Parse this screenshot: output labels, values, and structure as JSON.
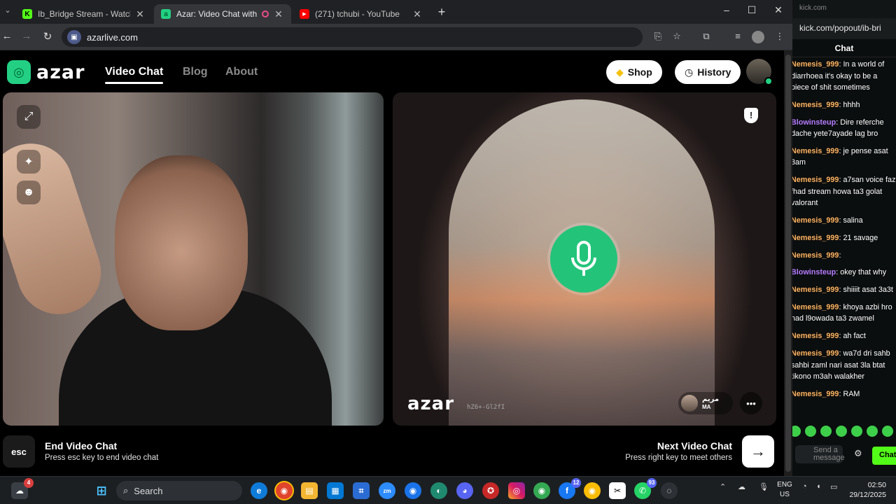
{
  "browser": {
    "tabs": [
      {
        "title": "Ib_Bridge Stream - Watch Live o",
        "favicon": "kick-k"
      },
      {
        "title": "Azar: Video Chat with New",
        "favicon": "azar"
      },
      {
        "title": "(271) tchubi - YouTube",
        "favicon": "youtube"
      }
    ],
    "url": "azarlive.com"
  },
  "azar": {
    "logo_text": "azar",
    "nav": [
      "Video Chat",
      "Blog",
      "About"
    ],
    "shop_label": "Shop",
    "history_label": "History",
    "watermark": "azar",
    "watermark_code": "hZ6+-Gl2fI",
    "partner_name": "مريم",
    "partner_country": "MA",
    "end_title": "End Video Chat",
    "end_sub": "Press esc key to end video chat",
    "esc_label": "esc",
    "next_title": "Next Video Chat",
    "next_sub": "Press right key to meet others",
    "colors": {
      "accent": "#23d083",
      "mic": "#23c47a"
    }
  },
  "popout": {
    "window_title": "kick.com",
    "url": "kick.com/popout/ib-bri",
    "chat_title": "Chat",
    "messages": [
      {
        "user": "Nemesis_999",
        "text": "In a world of diarrhoea it's okay to be a piece of shit sometimes",
        "color": "#ffb25e"
      },
      {
        "user": "Nemesis_999",
        "text": "hhhh",
        "color": "#ffb25e"
      },
      {
        "user": "Blowinsteup",
        "text": "Dire referche dache yete7ayade lag bro",
        "color": "#b57cff"
      },
      {
        "user": "Nemesis_999",
        "text": "je pense asat 3am",
        "color": "#ffb25e"
      },
      {
        "user": "Nemesis_999",
        "text": "a7san voice faz fhad stream howa ta3 golat valorant",
        "color": "#ffb25e"
      },
      {
        "user": "Nemesis_999",
        "text": "salina",
        "color": "#ffb25e"
      },
      {
        "user": "Nemesis_999",
        "text": "21 savage",
        "color": "#ffb25e"
      },
      {
        "user": "Nemesis_999",
        "text": "",
        "color": "#ffb25e"
      },
      {
        "user": "Blowinsteup",
        "text": "okey that why",
        "color": "#b57cff"
      },
      {
        "user": "Nemesis_999",
        "text": "shiiiit asat 3a3t",
        "color": "#ffb25e"
      },
      {
        "user": "Nemesis_999",
        "text": "khoya azbi hro had l9owada ta3 zwamel",
        "color": "#ffb25e"
      },
      {
        "user": "Nemesis_999",
        "text": "ah fact",
        "color": "#ffb25e"
      },
      {
        "user": "Nemesis_999",
        "text": "wa7d dri sahb sahbi zaml nari asat 3la btat tikono m3ah walakher",
        "color": "#ffb25e"
      },
      {
        "user": "Nemesis_999",
        "text": "RAM",
        "color": "#ffb25e"
      }
    ],
    "send_placeholder": "Send a message",
    "chat_button": "Chat"
  },
  "taskbar": {
    "search_label": "Search",
    "lang": "ENG",
    "region": "US",
    "time": "02:50",
    "date": "29/12/2025",
    "badges": {
      "widgets": "4",
      "facebook": "12",
      "whatsapp": "93"
    }
  }
}
